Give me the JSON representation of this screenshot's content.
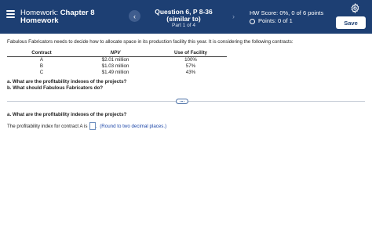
{
  "header": {
    "title_prefix": "Homework:",
    "chapter": "Chapter 8",
    "subtitle": "Homework",
    "question_title": "Question 6, P 8-36 (similar to)",
    "part": "Part 1 of 4",
    "hw_score": "HW Score: 0%, 0 of 6 points",
    "points": "Points: 0 of 1",
    "save_label": "Save",
    "prev_label": "‹",
    "next_label": "›"
  },
  "problem": {
    "intro": "Fabulous Fabricators needs to decide how to allocate space in its production facility this year. It is considering the following contracts:",
    "table": {
      "headers": [
        "Contract",
        "NPV",
        "Use of Facility"
      ],
      "rows": [
        [
          "A",
          "$2.01 million",
          "100%"
        ],
        [
          "B",
          "$1.03 million",
          "57%"
        ],
        [
          "C",
          "$1.49 million",
          "43%"
        ]
      ]
    },
    "questions": [
      "a. What are the profitability indexes of the projects?",
      "b. What should Fabulous Fabricators do?"
    ]
  },
  "answer": {
    "question": "a. What are the profitability indexes of the projects?",
    "prompt": "The profitability index for contract A is",
    "input_value": "",
    "hint": "(Round to two decimal places.)"
  },
  "colors": {
    "header_bg": "#1d3f73",
    "link": "#1d47a8"
  }
}
